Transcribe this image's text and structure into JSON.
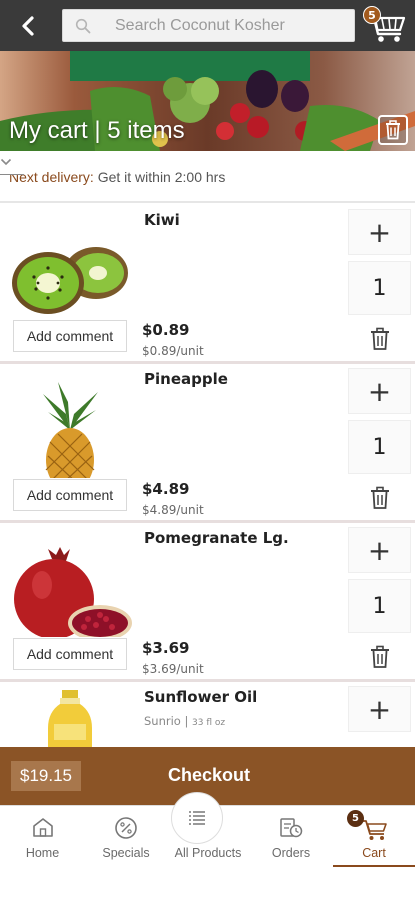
{
  "header": {
    "search_placeholder": "Search Coconut Kosher",
    "cart_count": "5"
  },
  "banner": {
    "title": "My cart | 5 items"
  },
  "delivery": {
    "label": "Next delivery:",
    "value": "Get it within 2:00 hrs"
  },
  "items": [
    {
      "name": "Kiwi",
      "price": "$0.89",
      "unit_price": "$0.89/unit",
      "quantity": "1",
      "comment_label": "Add comment"
    },
    {
      "name": "Pineapple",
      "price": "$4.89",
      "unit_price": "$4.89/unit",
      "quantity": "1",
      "comment_label": "Add comment"
    },
    {
      "name": "Pomegranate Lg.",
      "price": "$3.69",
      "unit_price": "$3.69/unit",
      "quantity": "1",
      "comment_label": "Add comment"
    },
    {
      "name": "Sunflower Oil",
      "brand": "Sunrio",
      "size": "33 fl oz"
    }
  ],
  "checkout": {
    "total": "$19.15",
    "label": "Checkout"
  },
  "nav": {
    "home": "Home",
    "specials": "Specials",
    "all_products": "All Products",
    "orders": "Orders",
    "cart": "Cart",
    "cart_badge": "5"
  },
  "colors": {
    "brand_brown": "#8b5426",
    "accent_text": "#8a4a1d",
    "topbar": "#3a3a3a"
  }
}
